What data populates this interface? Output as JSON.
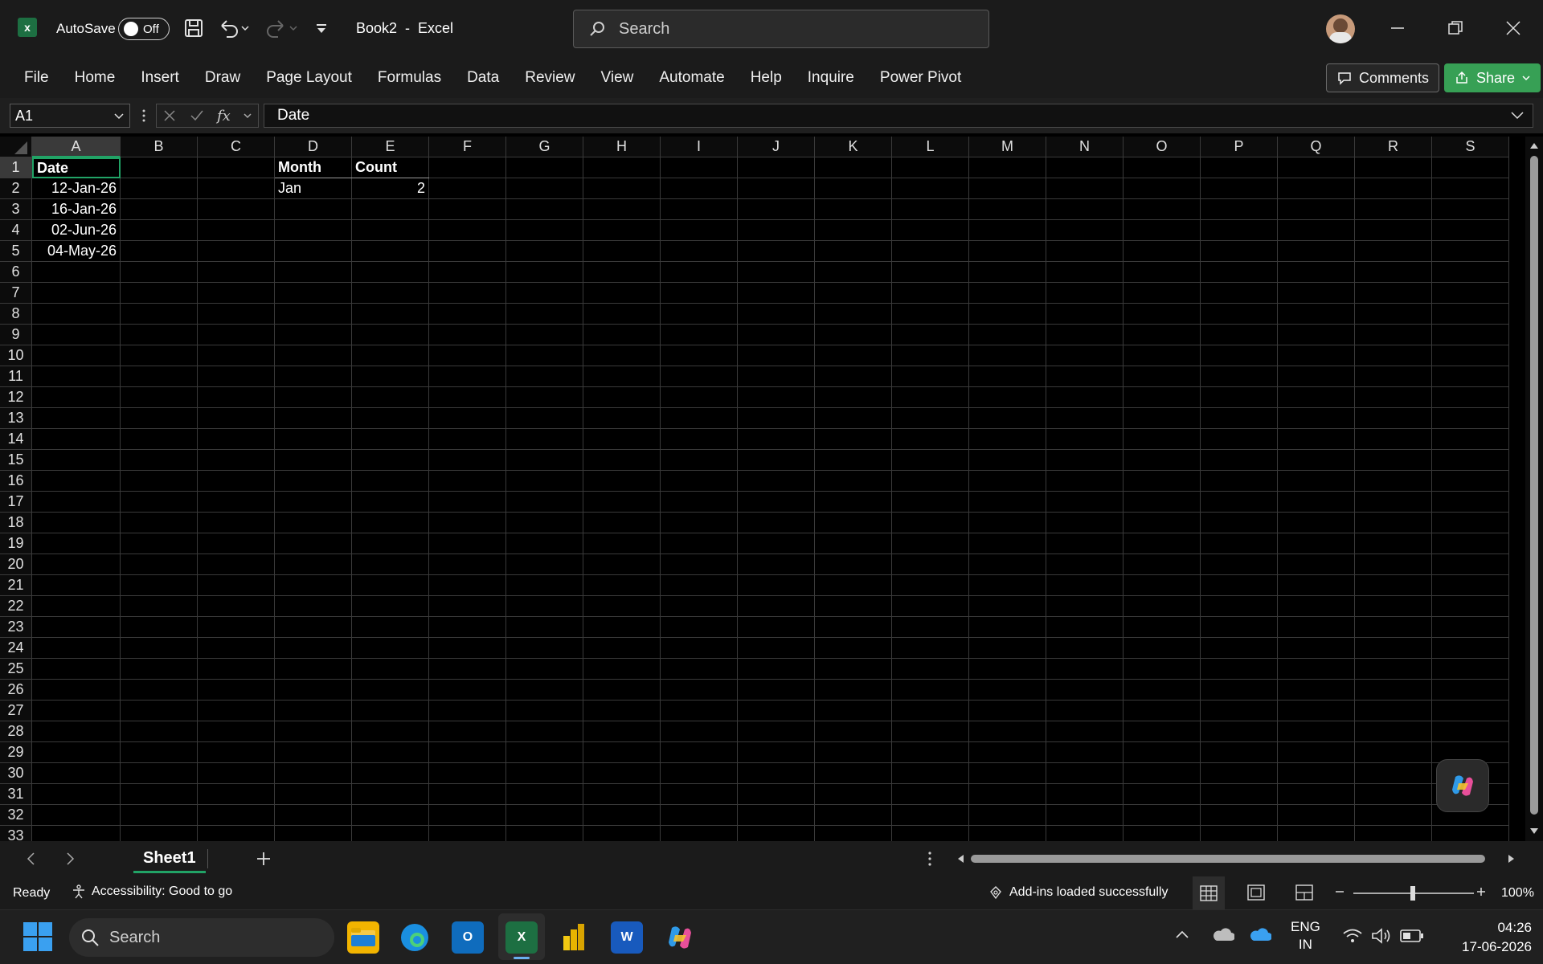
{
  "titlebar": {
    "autosave_label": "AutoSave",
    "autosave_state": "Off",
    "doc_title": "Book2  -  Excel",
    "search_placeholder": "Search"
  },
  "ribbon": {
    "tabs": [
      "File",
      "Home",
      "Insert",
      "Draw",
      "Page Layout",
      "Formulas",
      "Data",
      "Review",
      "View",
      "Automate",
      "Help",
      "Inquire",
      "Power Pivot"
    ],
    "comments_label": "Comments",
    "share_label": "Share"
  },
  "formula_bar": {
    "name_box": "A1",
    "formula": "Date"
  },
  "grid": {
    "columns": [
      "A",
      "B",
      "C",
      "D",
      "E",
      "F",
      "G",
      "H",
      "I",
      "J",
      "K",
      "L",
      "M",
      "N",
      "O",
      "P",
      "Q",
      "R",
      "S"
    ],
    "rows": [
      "1",
      "2",
      "3",
      "4",
      "5",
      "6",
      "7",
      "8",
      "9",
      "10",
      "11",
      "12",
      "13",
      "14",
      "15",
      "16",
      "17",
      "18",
      "19",
      "20",
      "21",
      "22",
      "23",
      "24",
      "25",
      "26",
      "27",
      "28",
      "29",
      "30",
      "31",
      "32",
      "33"
    ],
    "cells": {
      "A1": "Date",
      "A2": "12-Jan-26",
      "A3": "16-Jan-26",
      "A4": "02-Jun-26",
      "A5": "04-May-26",
      "D1": "Month",
      "E1": "Count",
      "D2": "Jan",
      "E2": "2"
    }
  },
  "sheets": {
    "active": "Sheet1"
  },
  "status": {
    "ready": "Ready",
    "accessibility": "Accessibility: Good to go",
    "addins": "Add-ins loaded successfully",
    "zoom": "100%"
  },
  "taskbar": {
    "search_placeholder": "Search",
    "lang_top": "ENG",
    "lang_bottom": "IN",
    "time": "04:26",
    "date": "17-06-2026"
  },
  "colors": {
    "accent": "#21a366",
    "share": "#37a055"
  }
}
